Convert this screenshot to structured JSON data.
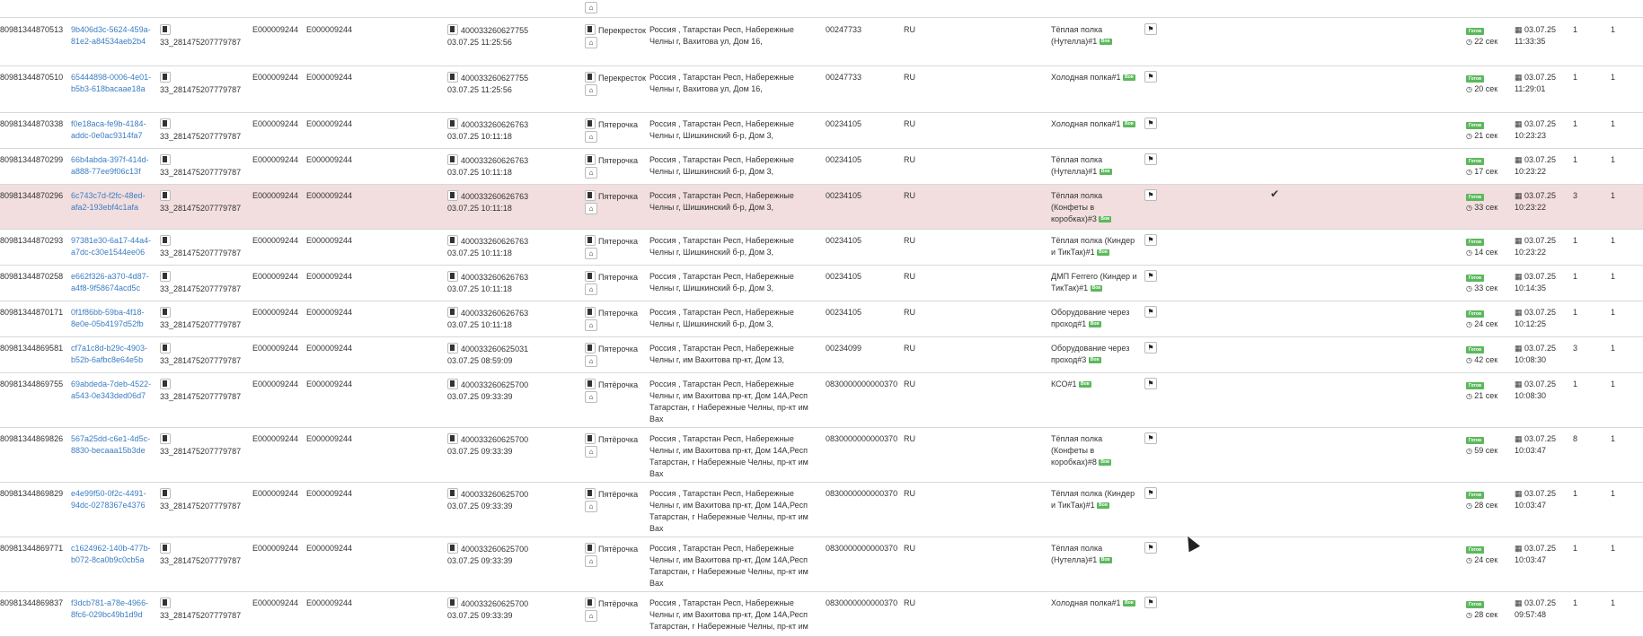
{
  "rows": [
    {
      "id": "80981344870513",
      "guid": [
        "9b406d3c-5624-459a-",
        "81e2-a84534aeb2b4"
      ],
      "doc": "33_281475207779787",
      "e1": "E000009244",
      "e2": "E000009244",
      "num": "400033260627755",
      "numdate": "03.07.25 11:25:56",
      "store": "Перекресток",
      "addr": [
        "Россия , Татарстан Респ, Набережные",
        "Челны г, Вахитова ул, Дом 16,"
      ],
      "code": "00247733",
      "country": "RU",
      "shelf": [
        "Тёплая полка",
        "(Нутелла)#1"
      ],
      "badge": "Вов",
      "checked": "",
      "status": "Готов",
      "dur": "22 сек",
      "date": "03.07.25",
      "time": "11:33:35",
      "c1": "1",
      "c2": "1"
    },
    {
      "id": "80981344870510",
      "guid": [
        "65444898-0006-4e01-",
        "b5b3-618bacaae18a"
      ],
      "doc": "33_281475207779787",
      "e1": "E000009244",
      "e2": "E000009244",
      "num": "400033260627755",
      "numdate": "03.07.25 11:25:56",
      "store": "Перекресток",
      "addr": [
        "Россия , Татарстан Респ, Набережные",
        "Челны г, Вахитова ул, Дом 16,"
      ],
      "code": "00247733",
      "country": "RU",
      "shelf": [
        "Холодная полка#1"
      ],
      "badge": "Вов",
      "checked": "",
      "status": "Готов",
      "dur": "20 сек",
      "date": "03.07.25",
      "time": "11:29:01",
      "c1": "1",
      "c2": "1"
    },
    {
      "id": "80981344870338",
      "guid": [
        "f0e18aca-fe9b-4184-",
        "addc-0e0ac9314fa7"
      ],
      "doc": "33_281475207779787",
      "e1": "E000009244",
      "e2": "E000009244",
      "num": "400033260626763",
      "numdate": "03.07.25 10:11:18",
      "store": "Пятерочка",
      "addr": [
        "Россия , Татарстан Респ, Набережные",
        "Челны г, Шишкинский б-р, Дом 3,"
      ],
      "code": "00234105",
      "country": "RU",
      "shelf": [
        "Холодная полка#1"
      ],
      "badge": "Вов",
      "checked": "",
      "status": "Готов",
      "dur": "21 сек",
      "date": "03.07.25",
      "time": "10:23:23",
      "c1": "1",
      "c2": "1"
    },
    {
      "id": "80981344870299",
      "guid": [
        "66b4abda-397f-414d-",
        "a888-77ee9f06c13f"
      ],
      "doc": "33_281475207779787",
      "e1": "E000009244",
      "e2": "E000009244",
      "num": "400033260626763",
      "numdate": "03.07.25 10:11:18",
      "store": "Пятерочка",
      "addr": [
        "Россия , Татарстан Респ, Набережные",
        "Челны г, Шишкинский б-р, Дом 3,"
      ],
      "code": "00234105",
      "country": "RU",
      "shelf": [
        "Тёплая полка",
        "(Нутелла)#1"
      ],
      "badge": "Вов",
      "checked": "",
      "status": "Готов",
      "dur": "17 сек",
      "date": "03.07.25",
      "time": "10:23:22",
      "c1": "1",
      "c2": "1"
    },
    {
      "id": "80981344870296",
      "guid": [
        "6c743c7d-f2fc-48ed-",
        "afa2-193ebf4c1afa"
      ],
      "doc": "33_281475207779787",
      "e1": "E000009244",
      "e2": "E000009244",
      "num": "400033260626763",
      "numdate": "03.07.25 10:11:18",
      "store": "Пятерочка",
      "addr": [
        "Россия , Татарстан Респ, Набережные",
        "Челны г, Шишкинский б-р, Дом 3,"
      ],
      "code": "00234105",
      "country": "RU",
      "shelf": [
        "Тёплая полка",
        "(Конфеты в",
        "коробках)#3"
      ],
      "badge": "Вов",
      "checked": "✔",
      "status": "Готов",
      "dur": "33 сек",
      "date": "03.07.25",
      "time": "10:23:22",
      "c1": "3",
      "c2": "1",
      "highlight": true
    },
    {
      "id": "80981344870293",
      "guid": [
        "97381e30-6a17-44a4-",
        "a7dc-c30e1544ee06"
      ],
      "doc": "33_281475207779787",
      "e1": "E000009244",
      "e2": "E000009244",
      "num": "400033260626763",
      "numdate": "03.07.25 10:11:18",
      "store": "Пятерочка",
      "addr": [
        "Россия , Татарстан Респ, Набережные",
        "Челны г, Шишкинский б-р, Дом 3,"
      ],
      "code": "00234105",
      "country": "RU",
      "shelf": [
        "Тёплая полка (Киндер",
        "и ТикТак)#1"
      ],
      "badge": "Вов",
      "checked": "",
      "status": "Готов",
      "dur": "14 сек",
      "date": "03.07.25",
      "time": "10:23:22",
      "c1": "1",
      "c2": "1"
    },
    {
      "id": "80981344870258",
      "guid": [
        "e662f326-a370-4d87-",
        "a4f8-9f58674acd5c"
      ],
      "doc": "33_281475207779787",
      "e1": "E000009244",
      "e2": "E000009244",
      "num": "400033260626763",
      "numdate": "03.07.25 10:11:18",
      "store": "Пятерочка",
      "addr": [
        "Россия , Татарстан Респ, Набережные",
        "Челны г, Шишкинский б-р, Дом 3,"
      ],
      "code": "00234105",
      "country": "RU",
      "shelf": [
        "ДМП Ferrero (Киндер и",
        "ТикТак)#1"
      ],
      "badge": "Вов",
      "checked": "",
      "status": "Готов",
      "dur": "33 сек",
      "date": "03.07.25",
      "time": "10:14:35",
      "c1": "1",
      "c2": "1"
    },
    {
      "id": "80981344870171",
      "guid": [
        "0f1f86bb-59ba-4f18-",
        "8e0e-05b4197d52fb"
      ],
      "doc": "33_281475207779787",
      "e1": "E000009244",
      "e2": "E000009244",
      "num": "400033260626763",
      "numdate": "03.07.25 10:11:18",
      "store": "Пятерочка",
      "addr": [
        "Россия , Татарстан Респ, Набережные",
        "Челны г, Шишкинский б-р, Дом 3,"
      ],
      "code": "00234105",
      "country": "RU",
      "shelf": [
        "Оборудование через",
        "проход#1"
      ],
      "badge": "Вов",
      "checked": "",
      "status": "Готов",
      "dur": "24 сек",
      "date": "03.07.25",
      "time": "10:12:25",
      "c1": "1",
      "c2": "1"
    },
    {
      "id": "80981344869581",
      "guid": [
        "cf7a1c8d-b29c-4903-",
        "b52b-6afbc8e64e5b"
      ],
      "doc": "33_281475207779787",
      "e1": "E000009244",
      "e2": "E000009244",
      "num": "400033260625031",
      "numdate": "03.07.25 08:59:09",
      "store": "Пятерочка",
      "addr": [
        "Россия , Татарстан Респ, Набережные",
        "Челны г, им Вахитова пр-кт, Дом 13,"
      ],
      "code": "00234099",
      "country": "RU",
      "shelf": [
        "Оборудование через",
        "проход#3"
      ],
      "badge": "Вов",
      "checked": "",
      "status": "Готов",
      "dur": "42 сек",
      "date": "03.07.25",
      "time": "10:08:30",
      "c1": "3",
      "c2": "1"
    },
    {
      "id": "80981344869755",
      "guid": [
        "69abdeda-7deb-4522-",
        "a543-0e343ded06d7"
      ],
      "doc": "33_281475207779787",
      "e1": "E000009244",
      "e2": "E000009244",
      "num": "400033260625700",
      "numdate": "03.07.25 09:33:39",
      "store": "Пятёрочка",
      "addr": [
        "Россия , Татарстан Респ, Набережные",
        "Челны г, им Вахитова пр-кт, Дом 14А,Респ",
        "Татарстан, г Набережные Челны, пр-кт им",
        "Вах"
      ],
      "code": "0830000000000370",
      "country": "RU",
      "shelf": [
        "КСО#1"
      ],
      "badge": "Вов",
      "checked": "",
      "status": "Готов",
      "dur": "21 сек",
      "date": "03.07.25",
      "time": "10:08:30",
      "c1": "1",
      "c2": "1"
    },
    {
      "id": "80981344869826",
      "guid": [
        "567a25dd-c6e1-4d5c-",
        "8830-becaaa15b3de"
      ],
      "doc": "33_281475207779787",
      "e1": "E000009244",
      "e2": "E000009244",
      "num": "400033260625700",
      "numdate": "03.07.25 09:33:39",
      "store": "Пятёрочка",
      "addr": [
        "Россия , Татарстан Респ, Набережные",
        "Челны г, им Вахитова пр-кт, Дом 14А,Респ",
        "Татарстан, г Набережные Челны, пр-кт им",
        "Вах"
      ],
      "code": "0830000000000370",
      "country": "RU",
      "shelf": [
        "Тёплая полка",
        "(Конфеты в",
        "коробках)#8"
      ],
      "badge": "Вов",
      "checked": "",
      "status": "Готов",
      "dur": "59 сек",
      "date": "03.07.25",
      "time": "10:03:47",
      "c1": "8",
      "c2": "1"
    },
    {
      "id": "80981344869829",
      "guid": [
        "e4e99f50-0f2c-4491-",
        "94dc-0278367e4376"
      ],
      "doc": "33_281475207779787",
      "e1": "E000009244",
      "e2": "E000009244",
      "num": "400033260625700",
      "numdate": "03.07.25 09:33:39",
      "store": "Пятёрочка",
      "addr": [
        "Россия , Татарстан Респ, Набережные",
        "Челны г, им Вахитова пр-кт, Дом 14А,Респ",
        "Татарстан, г Набережные Челны, пр-кт им",
        "Вах"
      ],
      "code": "0830000000000370",
      "country": "RU",
      "shelf": [
        "Тёплая полка (Киндер",
        "и ТикТак)#1"
      ],
      "badge": "Вов",
      "checked": "",
      "status": "Готов",
      "dur": "28 сек",
      "date": "03.07.25",
      "time": "10:03:47",
      "c1": "1",
      "c2": "1"
    },
    {
      "id": "80981344869771",
      "guid": [
        "c1624962-140b-477b-",
        "b072-8ca0b9c0cb5a"
      ],
      "doc": "33_281475207779787",
      "e1": "E000009244",
      "e2": "E000009244",
      "num": "400033260625700",
      "numdate": "03.07.25 09:33:39",
      "store": "Пятёрочка",
      "addr": [
        "Россия , Татарстан Респ, Набережные",
        "Челны г, им Вахитова пр-кт, Дом 14А,Респ",
        "Татарстан, г Набережные Челны, пр-кт им",
        "Вах"
      ],
      "code": "0830000000000370",
      "country": "RU",
      "shelf": [
        "Тёплая полка",
        "(Нутелла)#1"
      ],
      "badge": "Вов",
      "checked": "",
      "status": "Готов",
      "dur": "24 сек",
      "date": "03.07.25",
      "time": "10:03:47",
      "c1": "1",
      "c2": "1"
    },
    {
      "id": "80981344869837",
      "guid": [
        "f3dcb781-a78e-4966-",
        "8fc6-029bc49b1d9d"
      ],
      "doc": "33_281475207779787",
      "e1": "E000009244",
      "e2": "E000009244",
      "num": "400033260625700",
      "numdate": "03.07.25 09:33:39",
      "store": "Пятёрочка",
      "addr": [
        "Россия , Татарстан Респ, Набережные",
        "Челны г, им Вахитова пр-кт, Дом 14А,Респ",
        "Татарстан, г Набережные Челны, пр-кт им"
      ],
      "code": "0830000000000370",
      "country": "RU",
      "shelf": [
        "Холодная полка#1"
      ],
      "badge": "Вов",
      "checked": "",
      "status": "Готов",
      "dur": "28 сек",
      "date": "03.07.25",
      "time": "09:57:48",
      "c1": "1",
      "c2": "1"
    }
  ],
  "icons": {
    "file": "file-icon",
    "home": "home-icon",
    "flag": "flag-icon",
    "clock": "clock-icon",
    "calendar": "calendar-icon",
    "check": "check-icon"
  }
}
